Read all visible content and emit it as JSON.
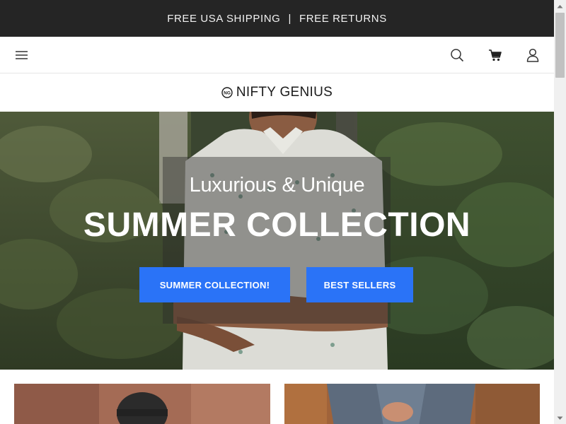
{
  "promo": {
    "left_text": "FREE USA SHIPPING",
    "separator": "|",
    "right_text": "FREE RETURNS"
  },
  "nav": {
    "menu_icon": "hamburger-menu-icon",
    "search_icon": "search-icon",
    "cart_icon": "cart-icon",
    "account_icon": "user-icon"
  },
  "brand": {
    "logo_mark": "NG",
    "name": "NIFTY GENIUS"
  },
  "hero": {
    "subtitle": "Luxurious & Unique",
    "title": "SUMMER COLLECTION",
    "buttons": [
      {
        "label": "SUMMER COLLECTION!"
      },
      {
        "label": "BEST SELLERS"
      }
    ],
    "button_color": "#2a73f7"
  },
  "colors": {
    "promo_bg": "#252525",
    "accent": "#2a73f7"
  }
}
